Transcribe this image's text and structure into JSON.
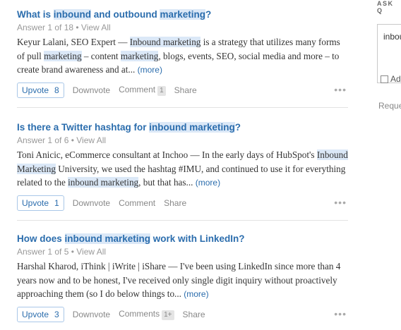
{
  "questions": [
    {
      "title_parts": [
        {
          "text": "What is ",
          "hl": false
        },
        {
          "text": "inbound",
          "hl": true
        },
        {
          "text": " and outbound ",
          "hl": false
        },
        {
          "text": "marketing",
          "hl": true
        },
        {
          "text": "?",
          "hl": false
        }
      ],
      "answer_count": "Answer 1 of 18",
      "view_all": "View All",
      "body_parts": [
        {
          "text": "Keyur Lalani, SEO Expert — ",
          "hl": false
        },
        {
          "text": "Inbound marketing",
          "hl": true
        },
        {
          "text": " is a strategy that utilizes many forms of pull ",
          "hl": false
        },
        {
          "text": "marketing",
          "hl": true
        },
        {
          "text": " – content ",
          "hl": false
        },
        {
          "text": "marketing",
          "hl": true
        },
        {
          "text": ", blogs, events, SEO, social media and more – to create brand awareness and at... ",
          "hl": false
        }
      ],
      "more": "(more)",
      "upvote_label": "Upvote",
      "upvote_count": "8",
      "downvote": "Downvote",
      "comment_label": "Comment",
      "comment_count": "1",
      "share": "Share",
      "menu": "•••"
    },
    {
      "title_parts": [
        {
          "text": "Is there a Twitter hashtag for ",
          "hl": false
        },
        {
          "text": "inbound marketing",
          "hl": true
        },
        {
          "text": "?",
          "hl": false
        }
      ],
      "answer_count": "Answer 1 of 6",
      "view_all": "View All",
      "body_parts": [
        {
          "text": "Toni Anicic, eCommerce consultant at Inchoo — In the early days of HubSpot's ",
          "hl": false
        },
        {
          "text": "Inbound Marketing",
          "hl": true
        },
        {
          "text": " University, we used the hashtag #IMU, and continued to use it for everything related to the ",
          "hl": false
        },
        {
          "text": "inbound marketing",
          "hl": true
        },
        {
          "text": ", but that has... ",
          "hl": false
        }
      ],
      "more": "(more)",
      "upvote_label": "Upvote",
      "upvote_count": "1",
      "downvote": "Downvote",
      "comment_label": "Comment",
      "comment_count": "",
      "share": "Share",
      "menu": "•••"
    },
    {
      "title_parts": [
        {
          "text": "How does ",
          "hl": false
        },
        {
          "text": "inbound marketing",
          "hl": true
        },
        {
          "text": " work with LinkedIn?",
          "hl": false
        }
      ],
      "answer_count": "Answer 1 of 5",
      "view_all": "View All",
      "body_parts": [
        {
          "text": "Harshal Kharod, iThink | iWrite | iShare — I've been using LinkedIn since more than 4 years now and to be honest, I've received only single digit inquiry without proactively approaching them (so I do below things to... ",
          "hl": false
        }
      ],
      "more": "(more)",
      "upvote_label": "Upvote",
      "upvote_count": "3",
      "downvote": "Downvote",
      "comment_label": "Comments",
      "comment_count": "1+",
      "share": "Share",
      "menu": "•••"
    }
  ],
  "sidebar": {
    "header": "ASK Q",
    "input_value": "inbou",
    "checkbox_label": "Ad",
    "request_label": "Reque"
  },
  "colors": {
    "link": "#2b6dad",
    "highlight": "#dbe8f7",
    "muted": "#999999"
  }
}
